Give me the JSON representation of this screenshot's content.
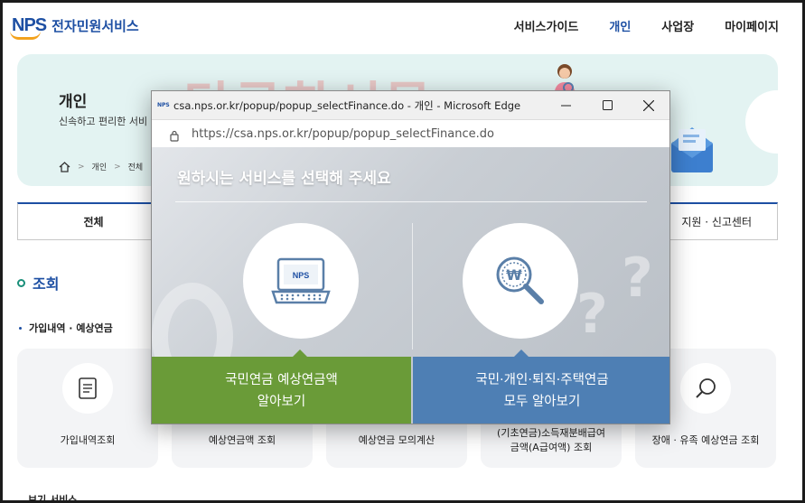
{
  "header": {
    "logo_mark": "NPS",
    "logo_text": "전자민원서비스",
    "nav": [
      "서비스가이드",
      "개인",
      "사업장",
      "마이페이지"
    ],
    "active_nav": "개인"
  },
  "hero": {
    "title": "개인",
    "desc": "신속하고 편리한 서비",
    "breadcrumb": [
      "개인",
      "전체"
    ],
    "watermark": "담쿵한서물"
  },
  "tabs": [
    "전체",
    "지원 · 신고센터"
  ],
  "section": {
    "title": "조회",
    "subtitle": "가입내역 · 예상연금"
  },
  "cards": [
    {
      "label": "가입내역조회",
      "icon": "document-icon"
    },
    {
      "label": "예상연금액 조회",
      "icon": ""
    },
    {
      "label": "예상연금 모의계산",
      "icon": ""
    },
    {
      "label": "(기초연금)소득재분배급여\n금액(A급여액) 조회",
      "icon": ""
    },
    {
      "label": "장애 · 유족 예상연금 조회",
      "icon": "magnifier-icon"
    }
  ],
  "bottom_cut_text": "보기 서비스",
  "popup": {
    "favicon": "NPS",
    "window_title": "csa.nps.or.kr/popup/popup_selectFinance.do - 개인 - Microsoft Edge",
    "url": "https://csa.nps.or.kr/popup/popup_selectFinance.do",
    "heading": "원하시는 서비스를 선택해 주세요",
    "laptop_logo": "NPS",
    "option_left": {
      "line1": "국민연금 예상연금액",
      "line2": "알아보기"
    },
    "option_right": {
      "line1": "국민·개인·퇴직·주택연금",
      "line2": "모두 알아보기"
    },
    "colors": {
      "green": "#6a9b38",
      "blue": "#4e7fb4"
    }
  }
}
